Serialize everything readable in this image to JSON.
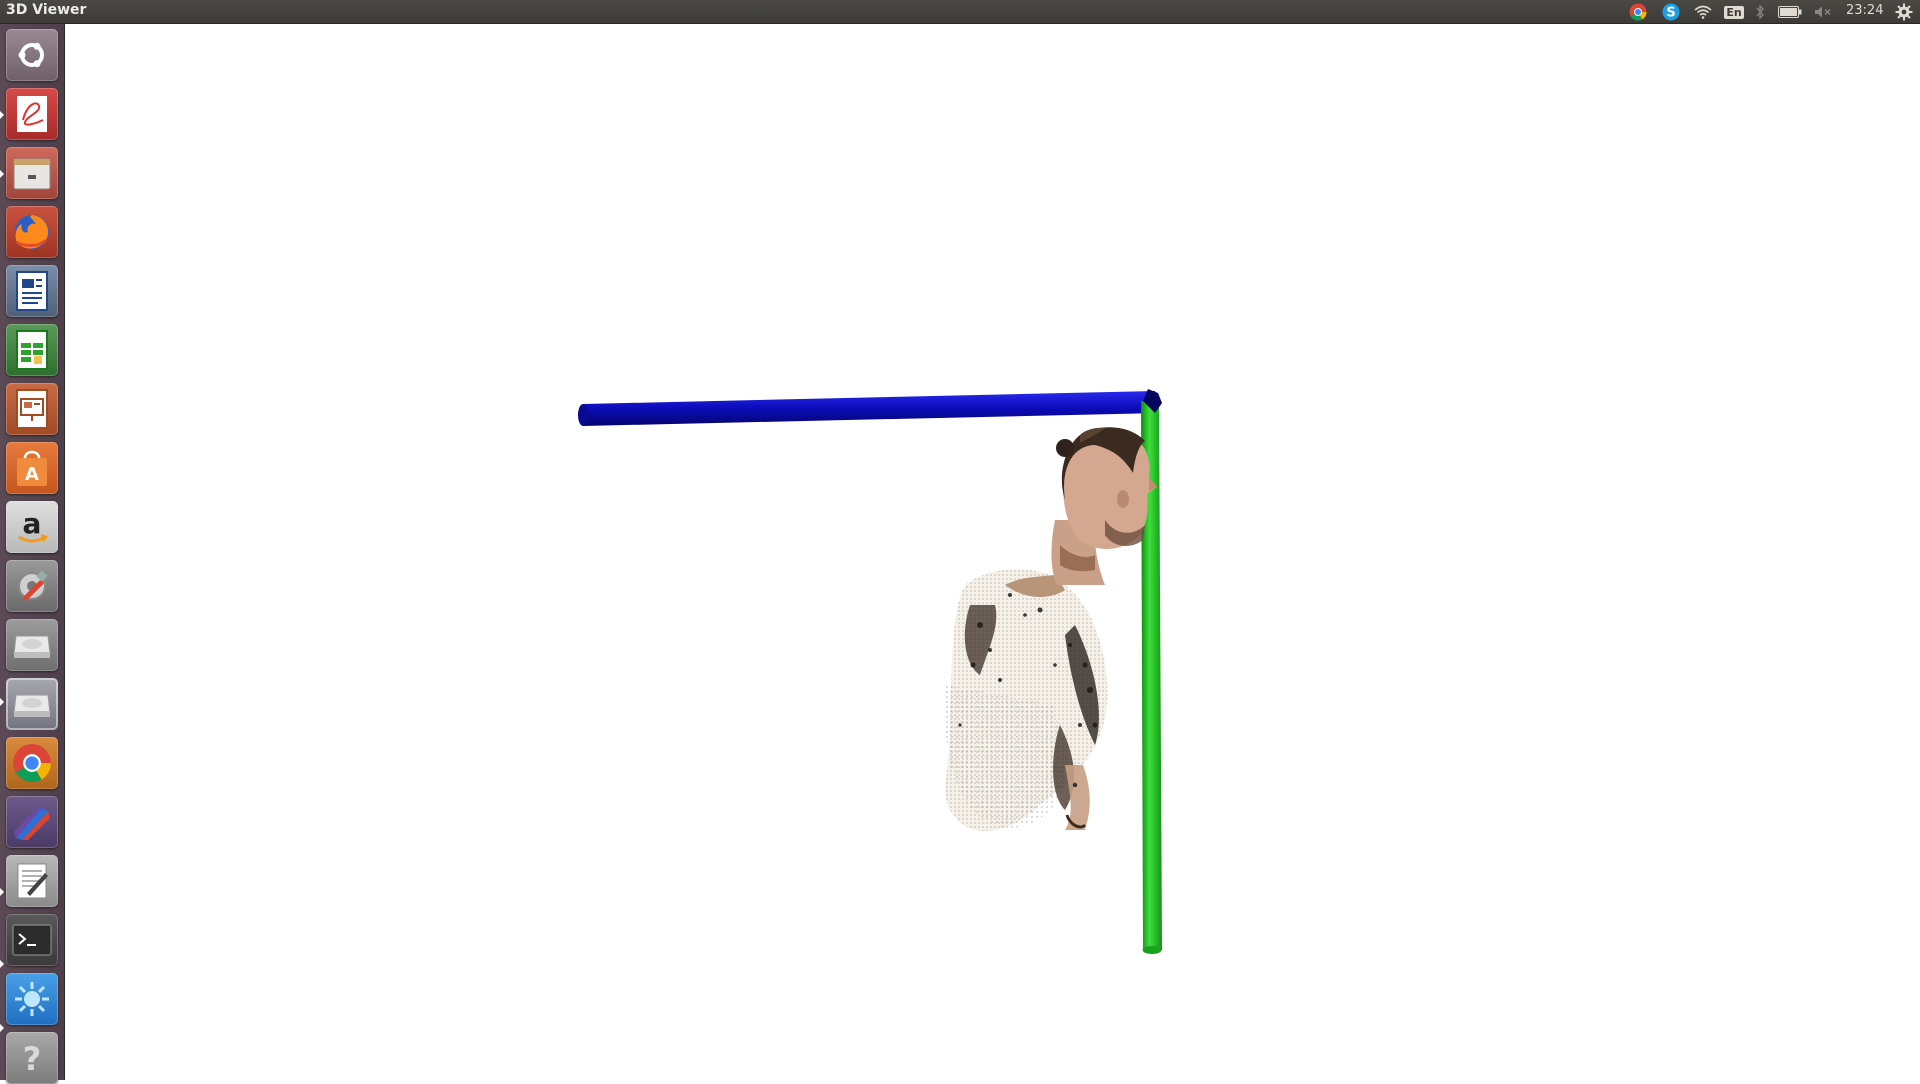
{
  "window": {
    "title": "3D Viewer"
  },
  "panel": {
    "clock": "23:24",
    "keyboard_layout": "En",
    "tray_icons": [
      "chrome-icon",
      "skype-icon",
      "wifi-icon",
      "keyboard-layout-icon",
      "bluetooth-icon",
      "battery-icon",
      "volume-muted-icon",
      "settings-gear-icon"
    ]
  },
  "launcher": {
    "items": [
      {
        "name": "ubuntu-dash",
        "icon": "ubuntu-logo-icon"
      },
      {
        "name": "document-viewer",
        "icon": "pdf-viewer-icon"
      },
      {
        "name": "files",
        "icon": "file-cabinet-icon"
      },
      {
        "name": "firefox",
        "icon": "firefox-icon"
      },
      {
        "name": "libreoffice-writer",
        "icon": "writer-document-icon"
      },
      {
        "name": "libreoffice-calc",
        "icon": "spreadsheet-icon"
      },
      {
        "name": "libreoffice-impress",
        "icon": "presentation-icon"
      },
      {
        "name": "software-center",
        "icon": "shopping-bag-icon"
      },
      {
        "name": "amazon",
        "icon": "amazon-icon"
      },
      {
        "name": "system-settings",
        "icon": "tools-gear-icon"
      },
      {
        "name": "drive-1",
        "icon": "hard-drive-icon"
      },
      {
        "name": "drive-2",
        "icon": "hard-drive-icon"
      },
      {
        "name": "chrome",
        "icon": "chrome-icon"
      },
      {
        "name": "colorful-app",
        "icon": "paint-app-icon"
      },
      {
        "name": "text-editor",
        "icon": "text-editor-icon"
      },
      {
        "name": "terminal",
        "icon": "terminal-icon"
      },
      {
        "name": "sunny-app",
        "icon": "sun-icon"
      },
      {
        "name": "help",
        "icon": "help-icon"
      }
    ]
  },
  "viewport": {
    "axis_colors": {
      "x_axis": "#0a0ab4",
      "y_axis": "#22cc22"
    },
    "model": "point-cloud-human-bust"
  }
}
